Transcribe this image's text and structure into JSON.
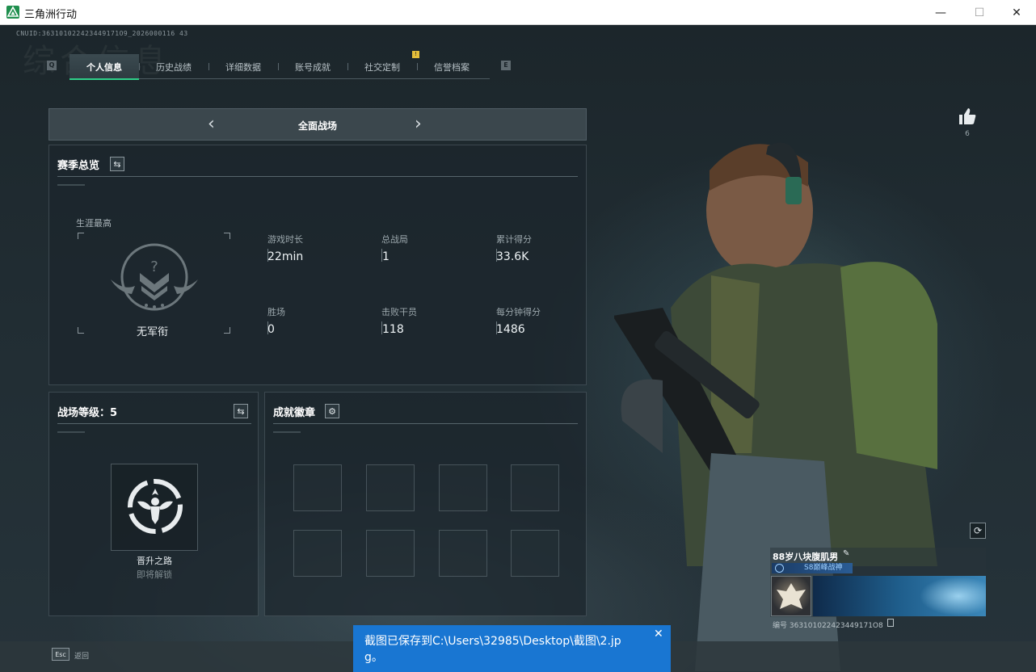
{
  "window": {
    "title": "三角洲行动",
    "minimize": "—",
    "maximize": "☐",
    "close": "✕"
  },
  "uid": "CNUID:363101022423449171O9_2026000116 43",
  "watermark": "综合信息",
  "tabs": {
    "left_key": "Q",
    "right_key": "E",
    "items": [
      {
        "label": "个人信息",
        "active": true
      },
      {
        "label": "历史战绩",
        "active": false
      },
      {
        "label": "详细数据",
        "active": false
      },
      {
        "label": "账号成就",
        "active": false
      },
      {
        "label": "社交定制",
        "active": false
      },
      {
        "label": "信誉档案",
        "active": false
      }
    ],
    "flag": "!"
  },
  "mode": {
    "title": "全面战场",
    "prev": "‹",
    "next": "›"
  },
  "season": {
    "title": "赛季总览",
    "career_high_label": "生涯最高",
    "rank_name": "无军衔",
    "stats": [
      {
        "label": "游戏时长",
        "value": "22min"
      },
      {
        "label": "总战局",
        "value": "1"
      },
      {
        "label": "累计得分",
        "value": "33.6K"
      },
      {
        "label": "胜场",
        "value": "0"
      },
      {
        "label": "击败干员",
        "value": "118"
      },
      {
        "label": "每分钟得分",
        "value": "1486"
      }
    ]
  },
  "battlefield_level": {
    "title": "战场等级：5",
    "path_name": "晋升之路",
    "path_status": "即将解锁"
  },
  "achievements": {
    "title": "成就徽章"
  },
  "profile": {
    "like_count": "6",
    "player_name": "88岁八块腹肌男",
    "player_title": "S8巅峰战神",
    "id_text": "编号 363101022423449171O8"
  },
  "bottom": {
    "esc_key": "Esc",
    "back_label": "返回"
  },
  "toast": {
    "message": "截图已保存到C:\\Users\\32985\\Desktop\\截图\\2.jpg。",
    "close": "✕"
  }
}
